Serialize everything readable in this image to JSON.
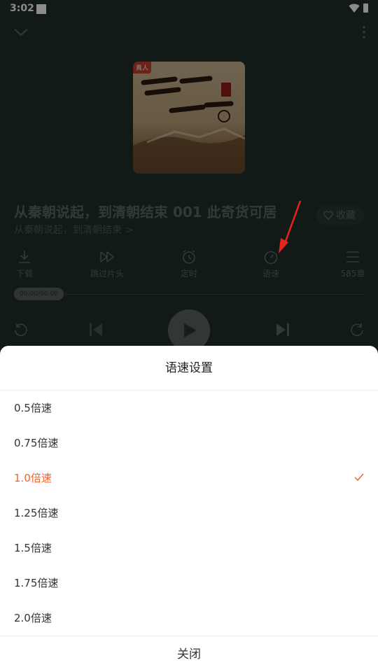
{
  "status_bar": {
    "time": "3:02"
  },
  "book": {
    "cover_tag": "真人",
    "title": "从秦朝说起，到清朝结束 001 此奇货可居",
    "album": "从秦朝说起，到清朝结束 >",
    "favorite_label": "收藏"
  },
  "toolbar": {
    "download": "下载",
    "skip_intro": "跳过片头",
    "timer": "定时",
    "speed": "语速",
    "chapters": "585章"
  },
  "progress": {
    "time_text": "00:00/00:00"
  },
  "speed_sheet": {
    "title": "语速设置",
    "options": [
      {
        "label": "0.5倍速",
        "selected": false
      },
      {
        "label": "0.75倍速",
        "selected": false
      },
      {
        "label": "1.0倍速",
        "selected": true
      },
      {
        "label": "1.25倍速",
        "selected": false
      },
      {
        "label": "1.5倍速",
        "selected": false
      },
      {
        "label": "1.75倍速",
        "selected": false
      },
      {
        "label": "2.0倍速",
        "selected": false
      }
    ],
    "close_label": "关闭"
  },
  "colors": {
    "accent": "#f0632f",
    "annotation": "#e8231c",
    "player_bg": "#21302b"
  }
}
